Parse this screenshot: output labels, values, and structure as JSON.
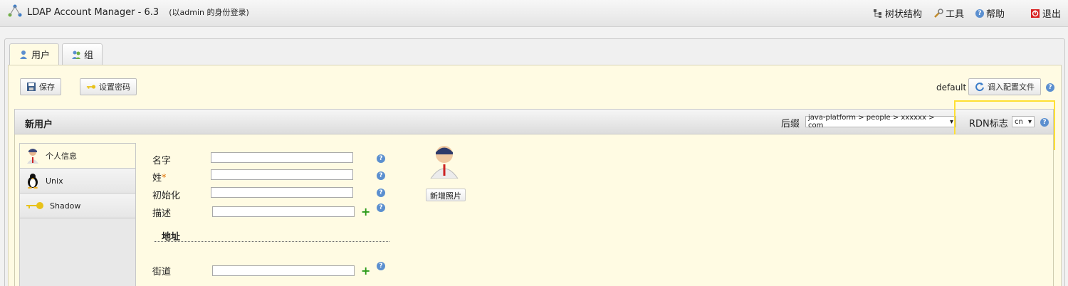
{
  "header": {
    "app_title": "LDAP Account Manager - 6.3",
    "app_subtitle": "(以admin 的身份登录)",
    "links": [
      {
        "label": "树状结构",
        "icon": "tree-icon"
      },
      {
        "label": "工具",
        "icon": "tools-icon"
      },
      {
        "label": "帮助",
        "icon": "help-icon"
      },
      {
        "label": "退出",
        "icon": "logout-icon"
      }
    ]
  },
  "tabs": [
    {
      "label": "用户",
      "icon": "user-icon"
    },
    {
      "label": "组",
      "icon": "group-icon"
    }
  ],
  "toolbar": {
    "save_label": "保存",
    "set_password_label": "设置密码",
    "profile_name": "default",
    "load_profile_label": "调入配置文件"
  },
  "panel": {
    "title": "新用户",
    "suffix_label": "后缀",
    "suffix_value": "java-platform > people > xxxxxx > com",
    "rdn_label": "RDN标志",
    "rdn_value": "cn"
  },
  "sidebar": {
    "items": [
      {
        "label": "个人信息",
        "icon": "person-icon"
      },
      {
        "label": "Unix",
        "icon": "tux-icon"
      },
      {
        "label": "Shadow",
        "icon": "key-icon"
      }
    ]
  },
  "form": {
    "first_name_label": "名字",
    "last_name_label": "姓",
    "initials_label": "初始化",
    "description_label": "描述",
    "address_section": "地址",
    "street_label": "街道"
  },
  "photo": {
    "add_photo_label": "新增照片"
  },
  "colors": {
    "content_bg": "#fffbe3",
    "highlight": "#ffe033",
    "help_icon": "#5b8fcf"
  }
}
